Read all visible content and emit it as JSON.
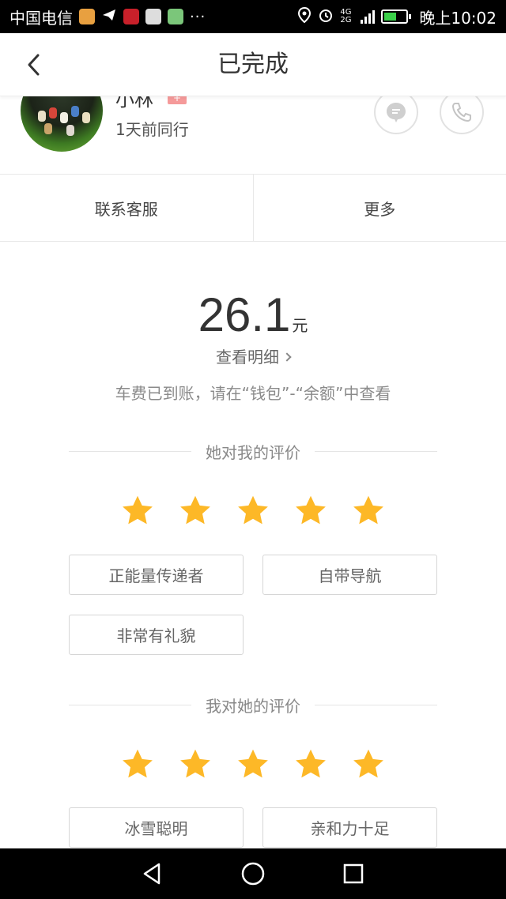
{
  "status_bar": {
    "carrier": "中国电信",
    "dots": "···",
    "network": "4G 2G",
    "time": "晚上10:02"
  },
  "header": {
    "title": "已完成"
  },
  "driver": {
    "name": "小林",
    "badge": "+",
    "trip_info": "1天前同行"
  },
  "actions": {
    "service_label": "联系客服",
    "more_label": "更多"
  },
  "fare": {
    "amount": "26.1",
    "unit": "元",
    "detail_link": "查看明细",
    "note": "车费已到账，请在“钱包”-“余额”中查看"
  },
  "rating_received": {
    "title": "她对我的评价",
    "stars": 5,
    "tags": [
      "正能量传递者",
      "自带导航",
      "非常有礼貌"
    ]
  },
  "rating_given": {
    "title": "我对她的评价",
    "stars": 5,
    "tags": [
      "冰雪聪明",
      "亲和力十足"
    ]
  },
  "colors": {
    "star": "#FDB827",
    "text_main": "#333333",
    "text_muted": "#888888",
    "divider": "#E5E5E5"
  }
}
